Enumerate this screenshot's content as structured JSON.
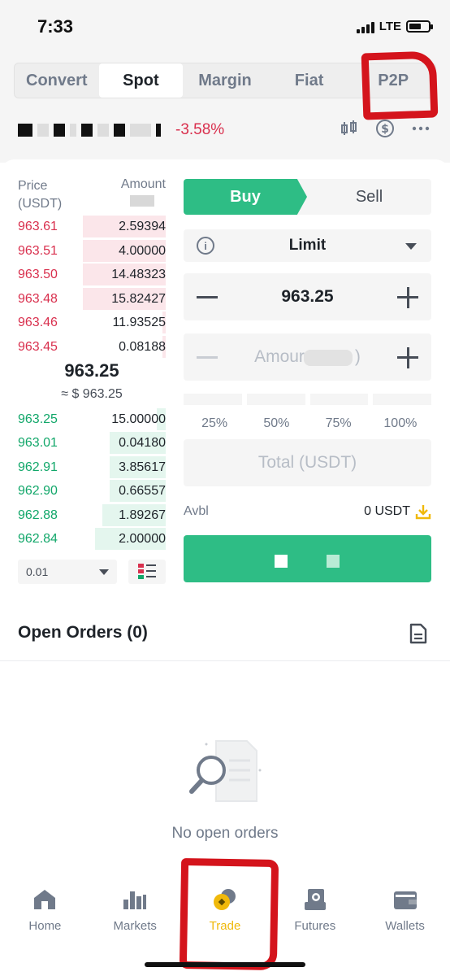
{
  "status_bar": {
    "time": "7:33",
    "network": "LTE"
  },
  "trade_tabs": [
    {
      "label": "Convert",
      "active": false
    },
    {
      "label": "Spot",
      "active": true
    },
    {
      "label": "Margin",
      "active": false
    },
    {
      "label": "Fiat",
      "active": false
    },
    {
      "label": "P2P",
      "active": false
    }
  ],
  "pair": {
    "change": "-3.58%"
  },
  "order_book": {
    "price_header": "Price\n(USDT)",
    "amount_header": "Amount",
    "asks": [
      {
        "price": "963.61",
        "amount": "2.59394",
        "depth": 0.56
      },
      {
        "price": "963.51",
        "amount": "4.00000",
        "depth": 0.56
      },
      {
        "price": "963.50",
        "amount": "14.48323",
        "depth": 0.56
      },
      {
        "price": "963.48",
        "amount": "15.82427",
        "depth": 0.56
      },
      {
        "price": "963.46",
        "amount": "11.93525",
        "depth": 0.02
      },
      {
        "price": "963.45",
        "amount": "0.08188",
        "depth": 0.02
      }
    ],
    "last_price": "963.25",
    "last_price_fiat": "≈ $ 963.25",
    "bids": [
      {
        "price": "963.25",
        "amount": "15.00000",
        "depth": 0.06
      },
      {
        "price": "963.01",
        "amount": "0.04180",
        "depth": 0.38
      },
      {
        "price": "962.91",
        "amount": "3.85617",
        "depth": 0.38
      },
      {
        "price": "962.90",
        "amount": "0.66557",
        "depth": 0.38
      },
      {
        "price": "962.88",
        "amount": "1.89267",
        "depth": 0.43
      },
      {
        "price": "962.84",
        "amount": "2.00000",
        "depth": 0.48
      }
    ],
    "depth_step": "0.01"
  },
  "trade_form": {
    "buy_label": "Buy",
    "sell_label": "Sell",
    "order_type": "Limit",
    "price_value": "963.25",
    "amount_placeholder": "Amour",
    "amount_placeholder_suffix": ")",
    "percent_options": [
      "25%",
      "50%",
      "75%",
      "100%"
    ],
    "total_placeholder": "Total (USDT)",
    "avbl_label": "Avbl",
    "avbl_value": "0 USDT"
  },
  "open_orders": {
    "title": "Open Orders (0)",
    "empty_text": "No open orders"
  },
  "bottom_nav": [
    {
      "label": "Home",
      "icon": "home-icon",
      "active": false
    },
    {
      "label": "Markets",
      "icon": "markets-icon",
      "active": false
    },
    {
      "label": "Trade",
      "icon": "trade-icon",
      "active": true
    },
    {
      "label": "Futures",
      "icon": "futures-icon",
      "active": false
    },
    {
      "label": "Wallets",
      "icon": "wallet-icon",
      "active": false
    }
  ],
  "colors": {
    "buy": "#2ebd85",
    "sell": "#d9304e",
    "accent": "#f0b90b",
    "annotation": "#d4141c"
  }
}
